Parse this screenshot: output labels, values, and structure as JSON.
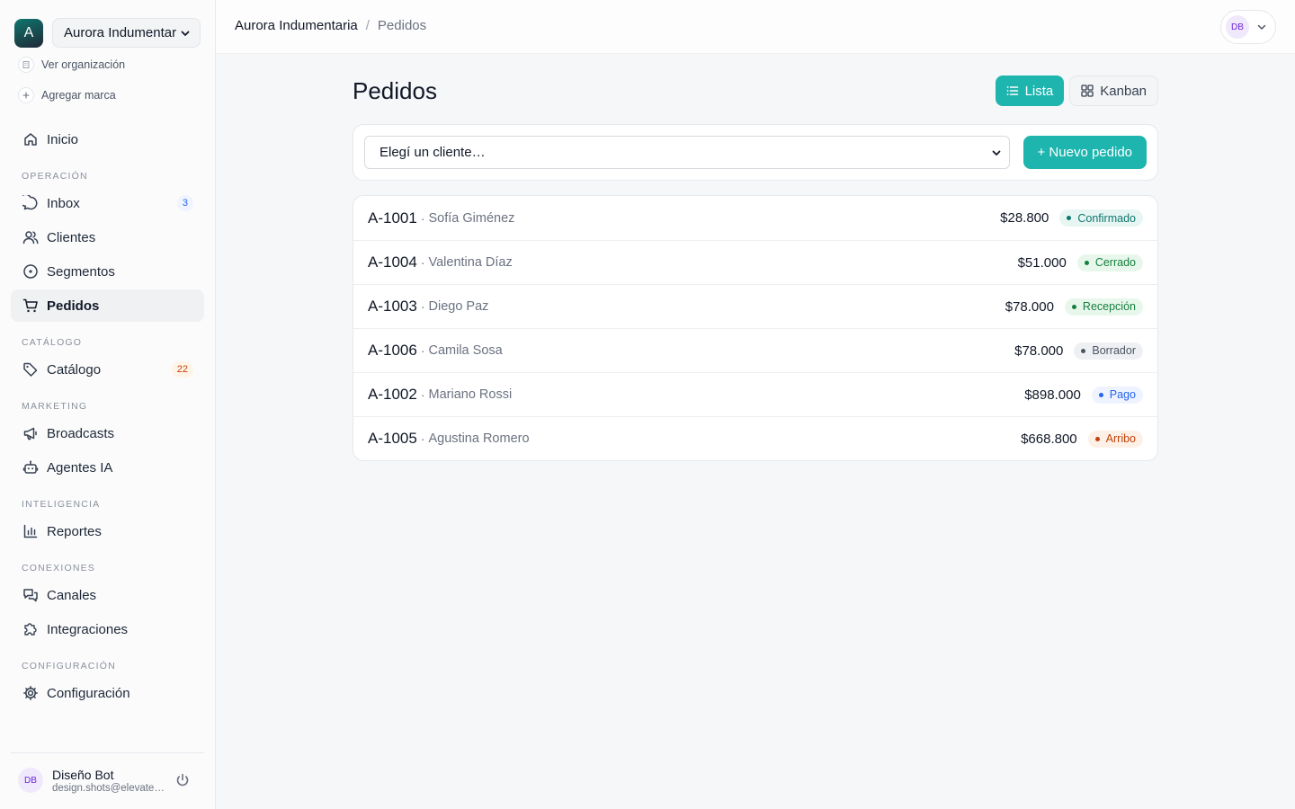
{
  "sidebar": {
    "org_initial": "A",
    "org_name": "Aurora Indumentaria",
    "view_org": "Ver organización",
    "add_brand": "Agregar marca",
    "home": "Inicio",
    "sections": {
      "operacion": "OPERACIÓN",
      "catalogo": "CATÁLOGO",
      "marketing": "MARKETING",
      "inteligencia": "INTELIGENCIA",
      "conexiones": "CONEXIONES",
      "configuracion": "CONFIGURACIÓN"
    },
    "items": {
      "inbox": {
        "label": "Inbox",
        "count": "3"
      },
      "clientes": {
        "label": "Clientes"
      },
      "segmentos": {
        "label": "Segmentos"
      },
      "pedidos": {
        "label": "Pedidos"
      },
      "catalogo": {
        "label": "Catálogo",
        "count": "22"
      },
      "broadcasts": {
        "label": "Broadcasts"
      },
      "agentes": {
        "label": "Agentes IA"
      },
      "reportes": {
        "label": "Reportes"
      },
      "canales": {
        "label": "Canales"
      },
      "integraciones": {
        "label": "Integraciones"
      },
      "configuracion": {
        "label": "Configuración"
      }
    },
    "user": {
      "initials": "DB",
      "name": "Diseño Bot",
      "email": "design.shots@elevate.example"
    }
  },
  "topbar": {
    "breadcrumb_org": "Aurora Indumentaria",
    "breadcrumb_sep": "/",
    "breadcrumb_current": "Pedidos",
    "account_initials": "DB"
  },
  "main": {
    "title": "Pedidos",
    "view_list": "Lista",
    "view_kanban": "Kanban",
    "client_select_value": "Elegí un cliente…",
    "new_order": "+ Nuevo pedido",
    "orders": [
      {
        "id": "A-1001",
        "client": "Sofía Giménez",
        "amount": "$28.800",
        "status": "Confirmado",
        "status_color": "#0f766e",
        "status_bg": "#e7f6f3"
      },
      {
        "id": "A-1004",
        "client": "Valentina Díaz",
        "amount": "$51.000",
        "status": "Cerrado",
        "status_color": "#15803d",
        "status_bg": "#e8f7ec"
      },
      {
        "id": "A-1003",
        "client": "Diego Paz",
        "amount": "$78.000",
        "status": "Recepción",
        "status_color": "#15803d",
        "status_bg": "#e8f7ec"
      },
      {
        "id": "A-1006",
        "client": "Camila Sosa",
        "amount": "$78.000",
        "status": "Borrador",
        "status_color": "#4b5563",
        "status_bg": "#eef0f3"
      },
      {
        "id": "A-1002",
        "client": "Mariano Rossi",
        "amount": "$898.000",
        "status": "Pago",
        "status_color": "#2563eb",
        "status_bg": "#eef3ff"
      },
      {
        "id": "A-1005",
        "client": "Agustina Romero",
        "amount": "$668.800",
        "status": "Arribo",
        "status_color": "#c2410c",
        "status_bg": "#fdf1e7"
      }
    ]
  },
  "colors": {
    "accent": "#1eb5ae",
    "sidebar_bg": "#fbfbfc",
    "page_bg": "#f6f7f8"
  },
  "icons": [
    "home-icon",
    "chat-icon",
    "users-icon",
    "segment-icon",
    "cart-icon",
    "tag-icon",
    "megaphone-icon",
    "robot-icon",
    "bar-chart-icon",
    "channels-icon",
    "puzzle-icon",
    "gear-icon",
    "power-icon",
    "list-icon",
    "grid-icon",
    "chevron-down-icon",
    "building-icon",
    "plus-icon"
  ]
}
